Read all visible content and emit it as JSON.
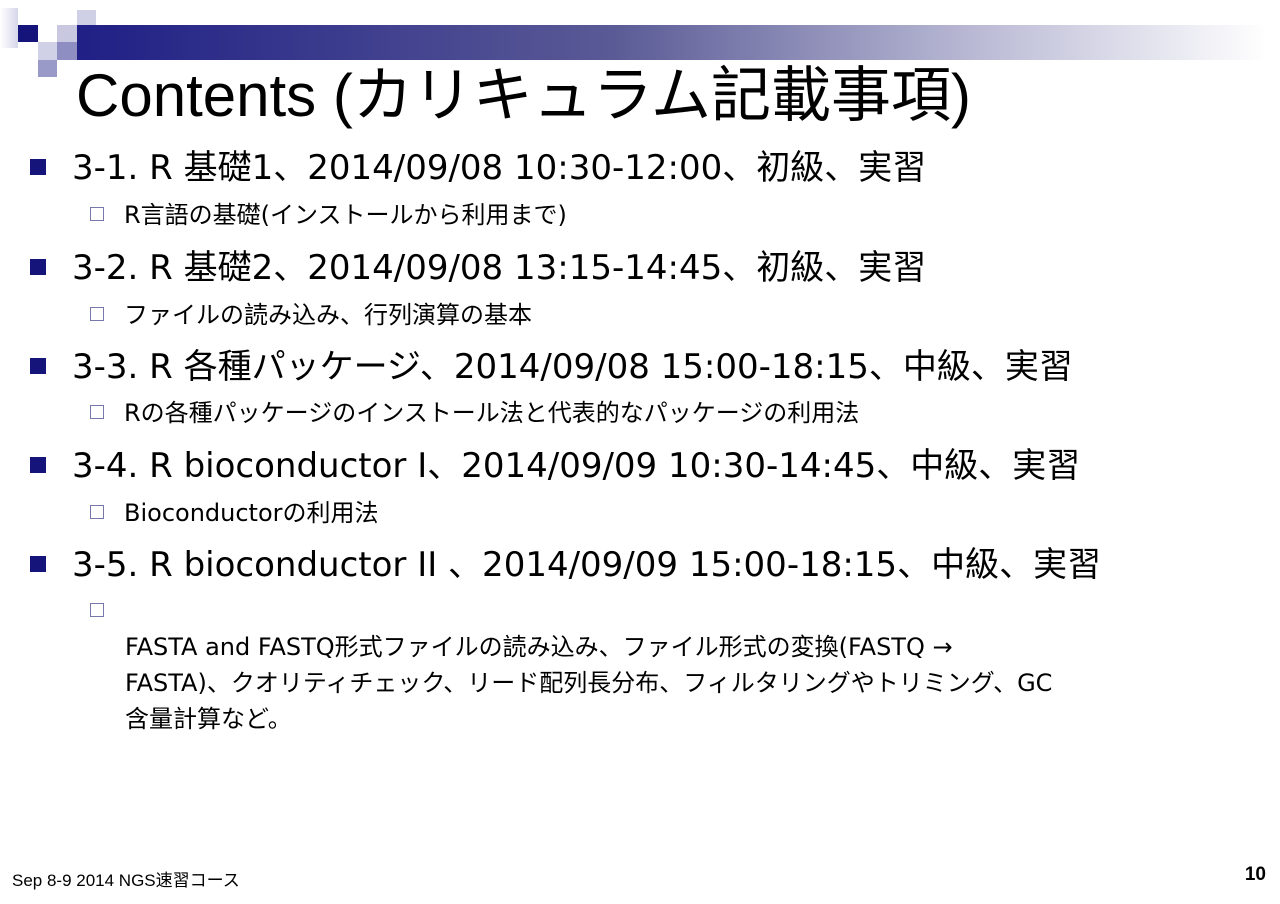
{
  "title": "Contents (カリキュラム記載事項)",
  "items": [
    {
      "label": "3-1. R 基礎1、2014/09/08 10:30-12:00、初級、実習",
      "sub": [
        "R言語の基礎(インストールから利用まで)"
      ]
    },
    {
      "label": "3-2. R 基礎2、2014/09/08 13:15-14:45、初級、実習",
      "sub": [
        "ファイルの読み込み、行列演算の基本"
      ]
    },
    {
      "label": "3-3. R 各種パッケージ、2014/09/08 15:00-18:15、中級、実習",
      "sub": [
        "Rの各種パッケージのインストール法と代表的なパッケージの利用法"
      ]
    },
    {
      "label": "3-4. R bioconductor I、2014/09/09 10:30-14:45、中級、実習",
      "sub": [
        "Bioconductorの利用法"
      ]
    },
    {
      "label": "3-5. R bioconductor II 、2014/09/09 15:00-18:15、中級、実習",
      "sub": [
        "FASTA and FASTQ形式ファイルの読み込み、ファイル形式の変換(FASTQ →",
        "FASTA)、クオリティチェック、リード配列長分布、フィルタリングやトリミング、GC",
        "含量計算など。"
      ]
    }
  ],
  "footer": "Sep 8-9 2014 NGS速習コース",
  "page_number": "10"
}
